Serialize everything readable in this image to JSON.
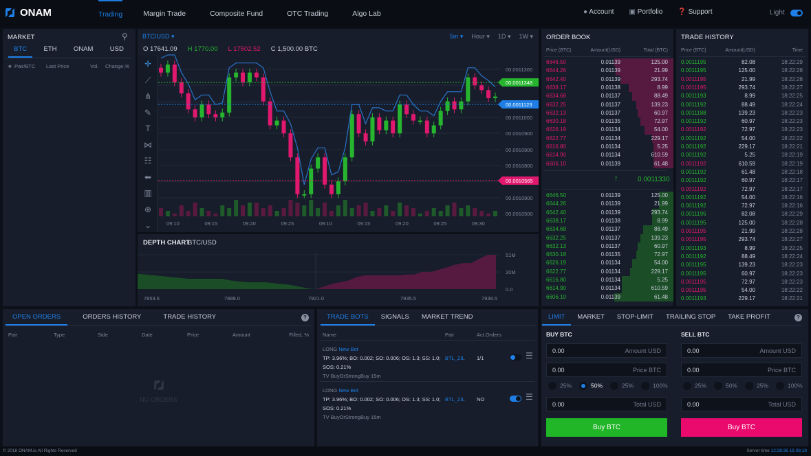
{
  "brand": "ONAM",
  "nav": [
    {
      "label": "Trading",
      "active": true
    },
    {
      "label": "Margin Trade"
    },
    {
      "label": "Composite Fund"
    },
    {
      "label": "OTC Trading"
    },
    {
      "label": "Algo Lab"
    }
  ],
  "user_nav": {
    "account": "Account",
    "portfolio": "Portfolio",
    "support": "Support",
    "theme_label": "Light",
    "theme_on": true
  },
  "colors": {
    "accent": "#1f7fe6",
    "up": "#27b52f",
    "down": "#e0196e"
  },
  "market": {
    "title": "MARKET",
    "tabs": [
      "BTC",
      "ETH",
      "ONAM",
      "USD"
    ],
    "active_tab": "BTC",
    "columns": [
      "Pair/BTC",
      "Last Price",
      "Vol.",
      "Change,%"
    ]
  },
  "chart": {
    "pair": "BTC/USD",
    "intervals": [
      "5m",
      "Hour",
      "1D",
      "1W"
    ],
    "active_interval": "5m",
    "ohlc": {
      "o": "O 17641.09",
      "h": "H 1770.00",
      "l": "L 17502.52",
      "c": "C 1,500.00 BTC"
    },
    "y_labels": [
      "00.0011300",
      "00.0011000",
      "00.0010900",
      "00.0010800",
      "00.0010800",
      "00.0010800",
      "00.0010500"
    ],
    "markers": [
      {
        "label": "00.0011348",
        "color": "#27b52f"
      },
      {
        "label": "00.0011123",
        "color": "#1f7fe6"
      },
      {
        "label": "00.0010565",
        "color": "#e0196e"
      }
    ],
    "x_labels": [
      "09:10",
      "09:15",
      "09:20",
      "09:25",
      "09:10",
      "09:15",
      "09:20",
      "09:25",
      "09:30"
    ],
    "tools": [
      "crosshair-icon",
      "trend-line-icon",
      "fork-icon",
      "brush-icon",
      "text-icon",
      "pattern-icon",
      "measure-icon",
      "back-arrow-icon",
      "indicators-icon",
      "zoom-in-icon",
      "chevron-down-icon"
    ]
  },
  "chart_data": [
    {
      "type": "candlestick",
      "closes": [
        0.001128,
        0.001133,
        0.001122,
        0.001115,
        0.001105,
        0.0011,
        0.001108,
        0.001102,
        0.0011,
        0.001103,
        0.001125,
        0.001128,
        0.001122,
        0.001128,
        0.001125,
        0.00111,
        0.001095,
        0.001098,
        0.00109,
        0.001075,
        0.001052,
        0.001052,
        0.001068,
        0.001075,
        0.001058,
        0.001052,
        0.00106,
        0.001075,
        0.001102,
        0.00109,
        0.001085,
        0.0011,
        0.001092,
        0.001098,
        0.00109,
        0.001108,
        0.001102,
        0.001098,
        0.001098,
        0.00109,
        0.001095,
        0.001104,
        0.00111,
        0.001105,
        0.00111,
        0.001125,
        0.00112,
        0.001117,
        0.001112,
        0.001113
      ],
      "volumes": [
        3,
        2,
        1,
        4,
        2,
        5,
        3,
        2,
        1,
        4,
        3,
        6,
        4,
        5,
        5,
        3,
        4,
        2,
        3,
        6,
        5,
        4,
        6,
        3,
        5,
        2,
        4,
        6,
        3,
        4,
        5,
        2,
        3,
        4,
        2,
        5,
        4,
        3,
        1,
        2,
        3,
        2,
        4,
        5,
        3,
        4,
        3,
        2,
        1,
        2
      ],
      "ylim": [
        0.00105,
        0.00114
      ]
    },
    {
      "type": "area",
      "title": "DEPTH CHART",
      "subtitle": "BTC/USD",
      "x_labels": [
        "7853.6",
        "7888.0",
        "7921.0",
        "7935.5",
        "7938.5"
      ],
      "y_labels": [
        "51M",
        "20M",
        "0.0"
      ],
      "bids": [
        18,
        17,
        16,
        15,
        14,
        13,
        12,
        12,
        12,
        12,
        12,
        10,
        9,
        8,
        8,
        8,
        7,
        6,
        5,
        3,
        1,
        0
      ],
      "asks": [
        0,
        3,
        6,
        8,
        10,
        14,
        16,
        16,
        16,
        16,
        16,
        17,
        17,
        20,
        20,
        24,
        28,
        33,
        36,
        36,
        44,
        51,
        51
      ]
    }
  ],
  "order_book": {
    "title": "ORDER BOOK",
    "columns": [
      "Price (BTC)",
      "Amount(USD)",
      "Total (BTC)"
    ],
    "asks": [
      [
        "6646.50",
        "0.01139",
        "125.00",
        45
      ],
      [
        "6644.26",
        "0.01139",
        "21.99",
        44
      ],
      [
        "6642.40",
        "0.01139",
        "293.74",
        40
      ],
      [
        "6638.17",
        "0.01138",
        "8.99",
        34
      ],
      [
        "6634.68",
        "0.01137",
        "88.49",
        31
      ],
      [
        "6632.25",
        "0.01137",
        "139.23",
        28
      ],
      [
        "6632.13",
        "0.01137",
        "60.97",
        27
      ],
      [
        "6630.18",
        "0.01135",
        "72.97",
        25
      ],
      [
        "6626.19",
        "0.01134",
        "54.00",
        22
      ],
      [
        "6622.77",
        "0.01134",
        "229.17",
        16
      ],
      [
        "6616.80",
        "0.01134",
        "5.25",
        15
      ],
      [
        "6614.90",
        "0.01134",
        "610.59",
        15
      ],
      [
        "6606.10",
        "0.01139",
        "61.48",
        15
      ]
    ],
    "last_price": "0.0011330",
    "bids": [
      [
        "6646.50",
        "0.01139",
        "125.00",
        11
      ],
      [
        "6644.26",
        "0.01139",
        "21.99",
        11
      ],
      [
        "6642.40",
        "0.01139",
        "293.74",
        16
      ],
      [
        "6638.17",
        "0.01138",
        "8.99",
        16
      ],
      [
        "6634.68",
        "0.01137",
        "88.49",
        23
      ],
      [
        "6632.25",
        "0.01137",
        "139.23",
        25
      ],
      [
        "6632.13",
        "0.01137",
        "60.97",
        27
      ],
      [
        "6630.18",
        "0.01135",
        "72.97",
        28
      ],
      [
        "6626.19",
        "0.01134",
        "54.00",
        31
      ],
      [
        "6622.77",
        "0.01134",
        "229.17",
        33
      ],
      [
        "6616.80",
        "0.01134",
        "5.25",
        39
      ],
      [
        "6614.90",
        "0.01134",
        "610.59",
        39
      ],
      [
        "6606.10",
        "0.01139",
        "61.48",
        45
      ]
    ]
  },
  "trade_history": {
    "title": "TRADE HISTORY",
    "columns": [
      "Price (BTC)",
      "Amount(USD)",
      "Time"
    ],
    "rows": [
      [
        "0.0011195",
        "82.08",
        "18:22:29",
        "buy"
      ],
      [
        "0.0011195",
        "125.00",
        "18:22:28",
        "buy"
      ],
      [
        "0.0011195",
        "21.99",
        "18:22:28",
        "sell"
      ],
      [
        "0.0011195",
        "293.74",
        "18:22:27",
        "sell"
      ],
      [
        "0.0011193",
        "8.99",
        "18:22:25",
        "buy"
      ],
      [
        "0.0011192",
        "88.49",
        "18:22:24",
        "buy"
      ],
      [
        "0.0011188",
        "139.23",
        "18:22:23",
        "buy"
      ],
      [
        "0.0011192",
        "60.97",
        "18:22:23",
        "buy"
      ],
      [
        "0.0011192",
        "72.97",
        "18:22:23",
        "sell"
      ],
      [
        "0.0011192",
        "54.00",
        "18:22:22",
        "buy"
      ],
      [
        "0.0011192",
        "229.17",
        "18:22:21",
        "buy"
      ],
      [
        "0.0011192",
        "5.25",
        "18:22:19",
        "buy"
      ],
      [
        "0.0011192",
        "610.59",
        "18:22:19",
        "sell"
      ],
      [
        "0.0011192",
        "61.48",
        "18:22:18",
        "buy"
      ],
      [
        "0.0011192",
        "60.97",
        "18:22:17",
        "buy"
      ],
      [
        "0.0011192",
        "72.97",
        "18:22:17",
        "sell"
      ],
      [
        "0.0011192",
        "54.00",
        "18:22:16",
        "buy"
      ],
      [
        "0.0011192",
        "72.97",
        "18:22:16",
        "buy"
      ],
      [
        "0.0011195",
        "82.08",
        "18:22:29",
        "buy"
      ],
      [
        "0.0011195",
        "125.00",
        "18:22:28",
        "buy"
      ],
      [
        "0.0011195",
        "21.99",
        "18:22:28",
        "sell"
      ],
      [
        "0.0011195",
        "293.74",
        "18:22:27",
        "sell"
      ],
      [
        "0.0011193",
        "8.99",
        "18:22:25",
        "buy"
      ],
      [
        "0.0011192",
        "88.49",
        "18:22:24",
        "buy"
      ],
      [
        "0.0011195",
        "139.23",
        "18:22:23",
        "buy"
      ],
      [
        "0.0011195",
        "60.97",
        "18:22:23",
        "buy"
      ],
      [
        "0.0011195",
        "72.97",
        "18:22:23",
        "sell"
      ],
      [
        "0.0011195",
        "54.00",
        "18:22:22",
        "sell"
      ],
      [
        "0.0011193",
        "229.17",
        "18:22:21",
        "buy"
      ]
    ]
  },
  "orders": {
    "tabs": [
      "OPEN ORDERS",
      "ORDERS HISTORY",
      "TRADE HISTORY"
    ],
    "columns": [
      "Pair",
      "Type",
      "Side",
      "Date",
      "Price",
      "Amount",
      "Filled, %"
    ],
    "empty": "NO ORDERS"
  },
  "bots": {
    "tabs": [
      "TRADE BOTS",
      "SIGNALS",
      "MARKET TREND"
    ],
    "columns": [
      "Name",
      "Pair",
      "Act.Orders"
    ],
    "items": [
      {
        "side": "LONG",
        "name": "New Bot",
        "params": "TP: 3.96%; BO: 0.002; SO: 0.006; OS: 1.3; SS: 1.0;",
        "params2": "SOS: 0.21%",
        "signal": "TV BuyOrStrongBuy 15m",
        "pair": "BTL_ZIL",
        "orders": "1/1",
        "enabled": false
      },
      {
        "side": "LONG",
        "name": "New Bot",
        "params": "TP: 3.96%; BO: 0.002; SO: 0.006; OS: 1.3; SS: 1.0;",
        "params2": "SOS: 0.21%",
        "signal": "TV BuyOrStrongBuy 15m",
        "pair": "BTL_ZIL",
        "orders": "NO",
        "enabled": true
      }
    ]
  },
  "form": {
    "tabs": [
      "LIMIT",
      "MARKET",
      "STOP-LIMIT",
      "TRAILING STOP",
      "TAKE PROFIT"
    ],
    "buy": {
      "title": "BUY BTC",
      "amount": "0.00",
      "amount_ph": "Amount USD",
      "price": "0.00",
      "price_ph": "Price BTC",
      "pcts": [
        "25%",
        "50%",
        "25%",
        "100%"
      ],
      "selected": "50%",
      "total": "0.00",
      "total_ph": "Total USD",
      "button": "Buy BTC"
    },
    "sell": {
      "title": "SELL BTC",
      "amount": "0.00",
      "amount_ph": "Amount USD",
      "price": "0.00",
      "price_ph": "Price BTC",
      "pcts": [
        "25%",
        "50%",
        "25%",
        "100%"
      ],
      "selected": null,
      "total": "0.00",
      "total_ph": "Total USD",
      "button": "Buy BTC"
    }
  },
  "footer": {
    "copyright": "© 2018 ONAM.io All Rights Reserved",
    "server_label": "Server time",
    "server_time": "12:28:36 19.08.18"
  }
}
